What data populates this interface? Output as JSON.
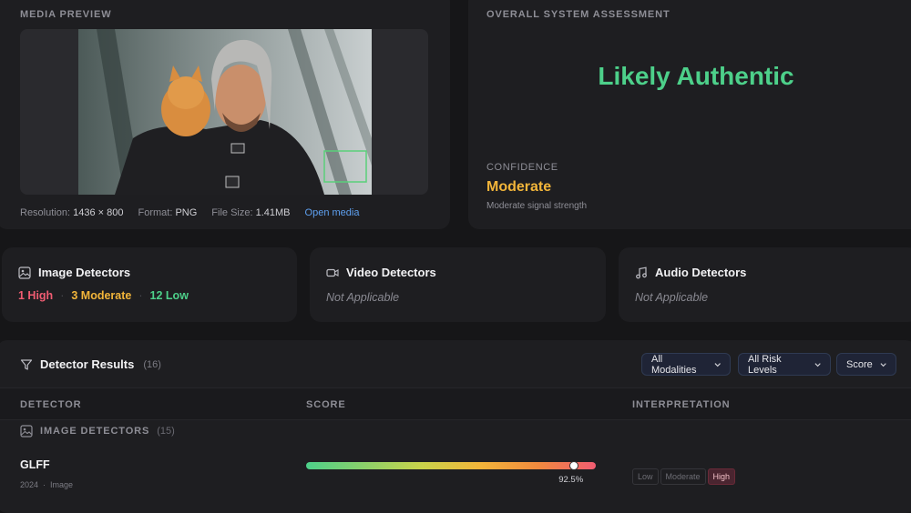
{
  "media": {
    "section_label": "MEDIA PREVIEW",
    "resolution_label": "Resolution:",
    "resolution": "1436 × 800",
    "format_label": "Format:",
    "format": "PNG",
    "size_label": "File Size:",
    "size": "1.41MB",
    "open_link": "Open media"
  },
  "assessment": {
    "section_label": "OVERALL SYSTEM ASSESSMENT",
    "verdict": "Likely Authentic",
    "confidence_label": "CONFIDENCE",
    "confidence": "Moderate",
    "confidence_note": "Moderate signal strength"
  },
  "detectors": {
    "image": {
      "title": "Image Detectors",
      "high": "1 High",
      "moderate": "3 Moderate",
      "low": "12 Low",
      "separator": "·"
    },
    "video": {
      "title": "Video Detectors",
      "status": "Not Applicable"
    },
    "audio": {
      "title": "Audio Detectors",
      "status": "Not Applicable"
    }
  },
  "results": {
    "title": "Detector Results",
    "count": "(16)",
    "filters": {
      "modalities": "All Modalities",
      "risk": "All Risk Levels",
      "sort": "Score"
    },
    "columns": {
      "detector": "DETECTOR",
      "score": "SCORE",
      "interpretation": "INTERPRETATION"
    },
    "group": {
      "label": "IMAGE DETECTORS",
      "count": "(15)"
    },
    "rows": [
      {
        "name": "GLFF",
        "year": "2024",
        "modality": "Image",
        "score": 92.5,
        "score_label": "92.5%",
        "levels": [
          "Low",
          "Moderate",
          "High"
        ],
        "active_level": "High"
      }
    ]
  },
  "colors": {
    "authentic": "#4dd08a",
    "moderate": "#f2b53a",
    "high": "#f05c72",
    "low": "#4dd08a",
    "link": "#5ea0f0"
  }
}
